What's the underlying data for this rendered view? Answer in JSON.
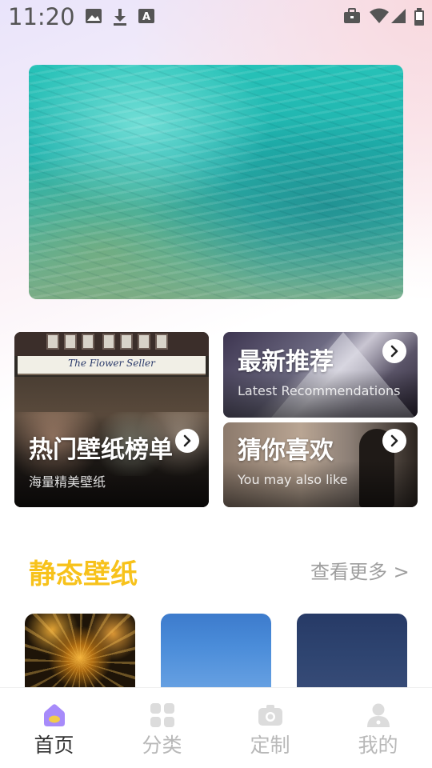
{
  "status_bar": {
    "time": "11:20",
    "icons": [
      "image-icon",
      "download-icon",
      "font-icon",
      "briefcase-icon",
      "wifi-icon",
      "signal-icon",
      "battery-icon"
    ]
  },
  "banner": {
    "image": "turquoise-water-wallpaper"
  },
  "cards": {
    "hot": {
      "title": "热门壁纸榜单",
      "subtitle": "海量精美壁纸",
      "shop_sign": "The Flower Seller",
      "image": "flower-shop-photo"
    },
    "latest": {
      "title": "最新推荐",
      "subtitle": "Latest Recommendations",
      "image": "snowy-mountain-photo"
    },
    "like": {
      "title": "猜你喜欢",
      "subtitle": "You may also like",
      "image": "man-portrait-photo"
    }
  },
  "section": {
    "title": "静态壁纸",
    "more": "查看更多 >",
    "thumbnails": [
      "golden-lights-wallpaper",
      "blue-sky-wallpaper",
      "navy-wallpaper"
    ]
  },
  "nav": {
    "items": [
      {
        "label": "首页",
        "icon": "home-icon",
        "active": true
      },
      {
        "label": "分类",
        "icon": "grid-icon",
        "active": false
      },
      {
        "label": "定制",
        "icon": "camera-icon",
        "active": false
      },
      {
        "label": "我的",
        "icon": "user-icon",
        "active": false
      }
    ]
  },
  "colors": {
    "accent_yellow": "#f7c21b",
    "nav_active_icon": "#a78bfa",
    "nav_inactive": "#b8b8b8"
  }
}
